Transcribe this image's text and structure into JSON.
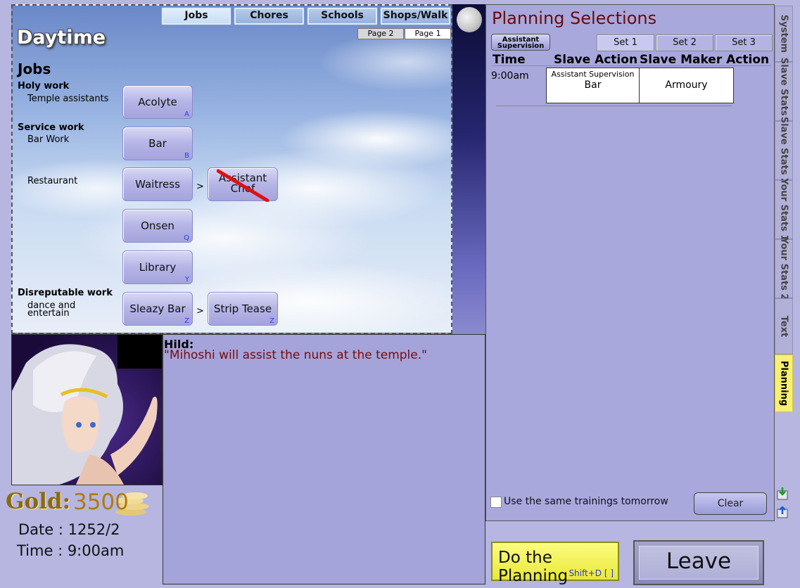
{
  "sky_panel": {
    "title": "Daytime",
    "tabs": [
      {
        "label": "Jobs",
        "active": true
      },
      {
        "label": "Chores",
        "active": false
      },
      {
        "label": "Schools",
        "active": false
      },
      {
        "label": "Shops/Walk",
        "active": false
      }
    ],
    "pages": [
      {
        "label": "Page 2",
        "active": false
      },
      {
        "label": "Page 1",
        "active": true
      }
    ],
    "heading": "Jobs",
    "categories": {
      "holy": {
        "label": "Holy work",
        "sub": "Temple assistants"
      },
      "service": {
        "label": "Service work",
        "sub_bar": "Bar Work",
        "sub_restaurant": "Restaurant"
      },
      "disreputable": {
        "label": "Disreputable work",
        "sub_line1": "dance and",
        "sub_line2": "entertain"
      }
    },
    "buttons": {
      "acolyte": {
        "label": "Acolyte",
        "hotkey": "A"
      },
      "bar": {
        "label": "Bar",
        "hotkey": "B"
      },
      "waitress": {
        "label": "Waitress",
        "hotkey": ""
      },
      "assistant_chef": {
        "line1": "Assistant",
        "line2": "Chef",
        "locked": true
      },
      "onsen": {
        "label": "Onsen",
        "hotkey": "Q"
      },
      "library": {
        "label": "Library",
        "hotkey": "Y"
      },
      "sleazy_bar": {
        "label": "Sleazy Bar",
        "hotkey": "Z"
      },
      "strip_tease": {
        "label": "Strip Tease",
        "hotkey": "Z"
      }
    },
    "arrow": ">"
  },
  "dialogue": {
    "speaker": "Hild:",
    "text": "\"Mihoshi will assist the nuns at the temple.\""
  },
  "stats": {
    "gold_label": "Gold:",
    "gold_value": "3500",
    "date": "Date : 1252/2",
    "time": "Time : 9:00am"
  },
  "planning": {
    "title": "Planning Selections",
    "assist_button_line1": "Assistant",
    "assist_button_line2": "Supervision",
    "sets": [
      {
        "label": "Set 1",
        "active": true
      },
      {
        "label": "Set 2",
        "active": false
      },
      {
        "label": "Set 3",
        "active": false
      }
    ],
    "columns": {
      "time": "Time",
      "slave_action": "Slave Action",
      "maker_action": "Slave Maker Action"
    },
    "rows": [
      {
        "time": "9:00am",
        "slave_action_top": "Assistant Supervision",
        "slave_action": "Bar",
        "maker_action": "Armoury"
      }
    ],
    "same_trainings_label": "Use the same trainings tomorrow",
    "same_trainings_checked": false,
    "clear_label": "Clear"
  },
  "side_tabs": [
    {
      "label": "System",
      "active": false
    },
    {
      "label": "Slave Stats 1",
      "active": false
    },
    {
      "label": "Slave Stats 2",
      "active": false
    },
    {
      "label": "Your Stats 1",
      "active": false
    },
    {
      "label": "Your Stats 2",
      "active": false
    },
    {
      "label": "Text",
      "active": false
    },
    {
      "label": "Planning",
      "active": true
    }
  ],
  "actions": {
    "do_planning_label": "Do the Planning",
    "do_planning_hotkey": "Shift+D  [  ]",
    "leave_label": "Leave"
  },
  "colors": {
    "background": "#b6b6e0",
    "planning_title": "#6a0a0a",
    "speech_text": "#7a0a0a",
    "gold": "#b07a10",
    "hotkey": "#2c3cf0",
    "active_side_tab": "#f8f070"
  }
}
